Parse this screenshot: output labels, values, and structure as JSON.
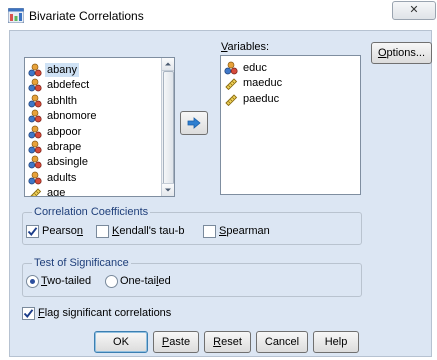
{
  "window": {
    "title": "Bivariate Correlations",
    "close_glyph": "✕"
  },
  "source_list": {
    "items": [
      {
        "label": "abany",
        "icon": "nominal-variable-icon"
      },
      {
        "label": "abdefect",
        "icon": "nominal-variable-icon"
      },
      {
        "label": "abhlth",
        "icon": "nominal-variable-icon"
      },
      {
        "label": "abnomore",
        "icon": "nominal-variable-icon"
      },
      {
        "label": "abpoor",
        "icon": "nominal-variable-icon"
      },
      {
        "label": "abrape",
        "icon": "nominal-variable-icon"
      },
      {
        "label": "absingle",
        "icon": "nominal-variable-icon"
      },
      {
        "label": "adults",
        "icon": "nominal-variable-icon"
      },
      {
        "label": "age",
        "icon": "scale-variable-icon"
      }
    ],
    "selected_index": 0
  },
  "move_button": {
    "icon": "move-right-arrow-icon"
  },
  "variables": {
    "label_pre": "",
    "label_ul": "V",
    "label_post": "ariables:",
    "items": [
      {
        "label": "educ",
        "icon": "nominal-variable-icon"
      },
      {
        "label": "maeduc",
        "icon": "scale-variable-icon"
      },
      {
        "label": "paeduc",
        "icon": "scale-variable-icon"
      }
    ]
  },
  "options_button": {
    "pre": "",
    "ul": "O",
    "post": "ptions..."
  },
  "correlation_coefficients": {
    "title": "Correlation Coefficients",
    "pearson": {
      "pre": "Pearso",
      "ul": "n",
      "post": "",
      "checked": true
    },
    "kendall": {
      "pre": "",
      "ul": "K",
      "post": "endall's tau-b",
      "checked": false
    },
    "spearman": {
      "pre": "",
      "ul": "S",
      "post": "pearman",
      "checked": false
    }
  },
  "test_of_significance": {
    "title": "Test of Significance",
    "two_tailed": {
      "pre": "",
      "ul": "T",
      "post": "wo-tailed",
      "selected": true
    },
    "one_tailed": {
      "pre": "One-tai",
      "ul": "l",
      "post": "ed",
      "selected": false
    }
  },
  "flag_significant": {
    "pre": "",
    "ul": "F",
    "post": "lag significant correlations",
    "checked": true
  },
  "buttons": {
    "ok": "OK",
    "paste": {
      "pre": "",
      "ul": "P",
      "post": "aste"
    },
    "reset": {
      "pre": "",
      "ul": "R",
      "post": "eset"
    },
    "cancel": "Cancel",
    "help": "Help"
  },
  "colors": {
    "dialog_bg": "#dce6f3",
    "group_title": "#1f3f7a",
    "check_mark": "#1c3d8a",
    "list_selection": "#cfe2f5"
  }
}
